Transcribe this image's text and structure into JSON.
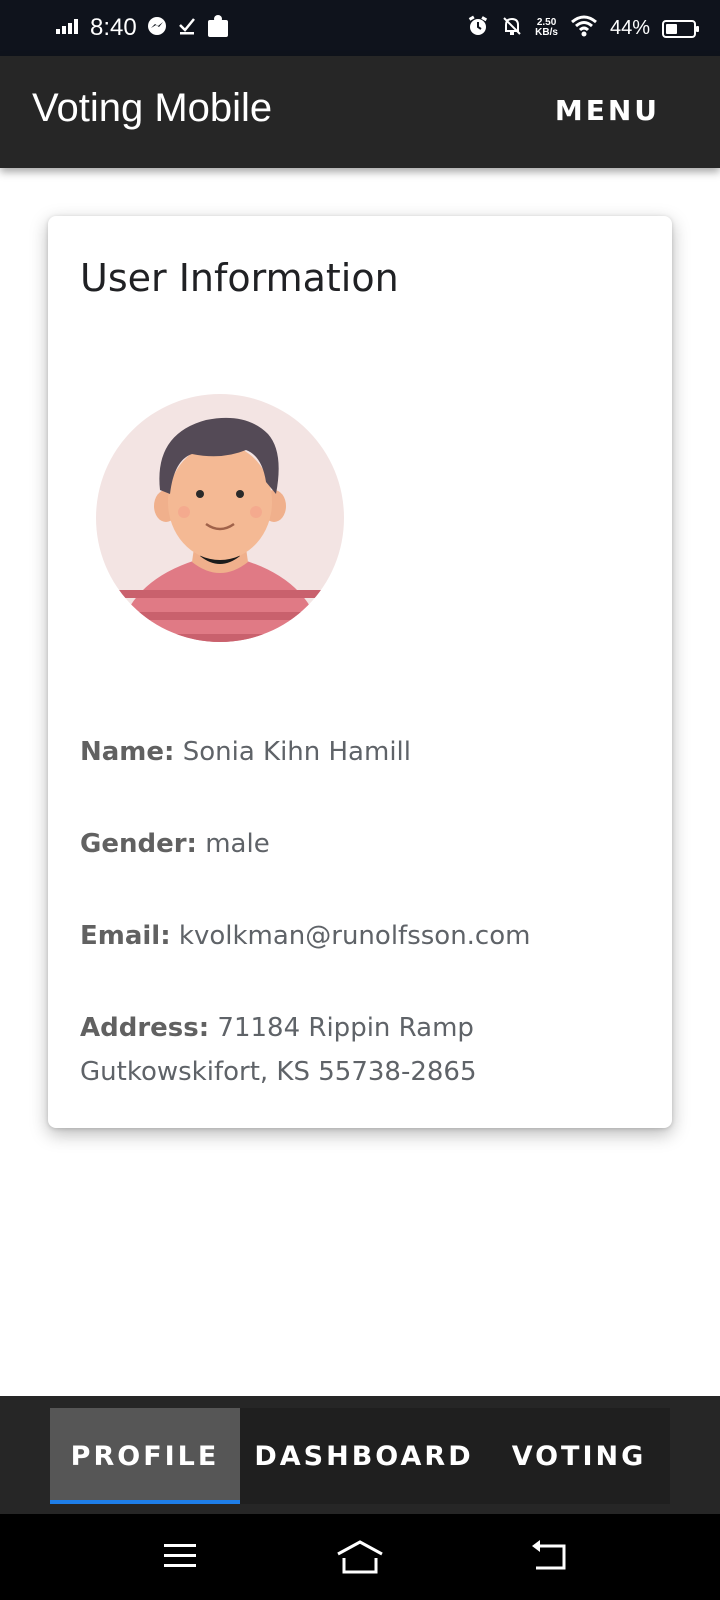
{
  "status_bar": {
    "time": "8:40",
    "network_speed_value": "2.50",
    "network_speed_unit": "KB/s",
    "battery_percent_label": "44%",
    "battery_level": 0.44,
    "icons": [
      "signal-icon",
      "messenger-icon",
      "checkmark-icon",
      "puzzle-icon",
      "alarm-icon",
      "mute-icon",
      "wifi-icon",
      "battery-icon"
    ]
  },
  "app_bar": {
    "title": "Voting Mobile",
    "menu_label": "MENU"
  },
  "card": {
    "title": "User Information",
    "avatar_icon": "user-avatar-icon",
    "fields": {
      "name_label": "Name:",
      "name_value": "Sonia Kihn Hamill",
      "gender_label": "Gender:",
      "gender_value": "male",
      "email_label": "Email:",
      "email_value": "kvolkman@runolfsson.com",
      "address_label": "Address:",
      "address_value": "71184 Rippin Ramp Gutkowskifort, KS 55738-2865"
    }
  },
  "tabs": [
    {
      "label": "PROFILE",
      "active": true
    },
    {
      "label": "DASHBOARD",
      "active": false
    },
    {
      "label": "VOTING",
      "active": false
    }
  ],
  "colors": {
    "status_bar_bg": "#0f131c",
    "app_bar_bg": "#262626",
    "active_tab_bg": "#565656",
    "active_tab_indicator": "#1e7ee8"
  },
  "nav_bar": {
    "icons": [
      "menu-icon",
      "home-icon",
      "back-icon"
    ]
  }
}
